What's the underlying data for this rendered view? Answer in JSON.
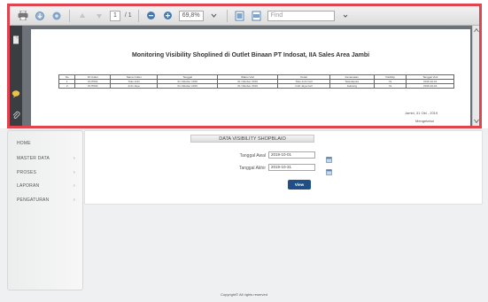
{
  "pdf_viewer": {
    "toolbar": {
      "page_current": "1",
      "page_total": "/ 1",
      "zoom": "69,8%",
      "find_placeholder": "Find"
    },
    "document": {
      "title": "Monitoring Visibility Shoplined di Outlet Binaan PT Indosat, IIA Sales Area Jambi",
      "table_headers": [
        "No",
        "ID Outlet",
        "Nama Outlet",
        "Tanggal",
        "Waktu Visit",
        "Outlet",
        "Kecamatan",
        "Visibility",
        "Tanggal Visit"
      ],
      "table_rows": [
        [
          "1",
          "OUT001",
          "Toko Indri",
          "01 Oktober 2019",
          "01 Oktober 2019",
          "Toko Indri Cell",
          "Telanaipura",
          "Ya",
          "2019-10-01"
        ],
        [
          "2",
          "OUT002",
          "Indri Jaya",
          "01 Oktober 2019",
          "01 Oktober 2019",
          "Indri Jaya Cell",
          "Jelutung",
          "Ya",
          "2019-10-01"
        ]
      ],
      "sign_location_date": "Jambi, 31 Okt - 2019",
      "sign_role": "Mengetahui"
    }
  },
  "sidebar": {
    "items": [
      {
        "label": "HOME",
        "has_arrow": false
      },
      {
        "label": "MASTER DATA",
        "has_arrow": true
      },
      {
        "label": "PROSES",
        "has_arrow": true
      },
      {
        "label": "LAPORAN",
        "has_arrow": true
      },
      {
        "label": "PENGATURAN",
        "has_arrow": true
      }
    ],
    "arrow_glyph": "›"
  },
  "form": {
    "header": "DATA VISIBILITY SHOPBLAIO",
    "start_label": "Tanggal Awal",
    "start_value": "2019-10-01",
    "end_label": "Tanggal Akhir",
    "end_value": "2019-10-31",
    "submit_label": "View"
  },
  "footer": {
    "text": "Copyright© All rights reserved"
  },
  "colors": {
    "frame_border": "#e0454f",
    "button": "#214f85"
  }
}
